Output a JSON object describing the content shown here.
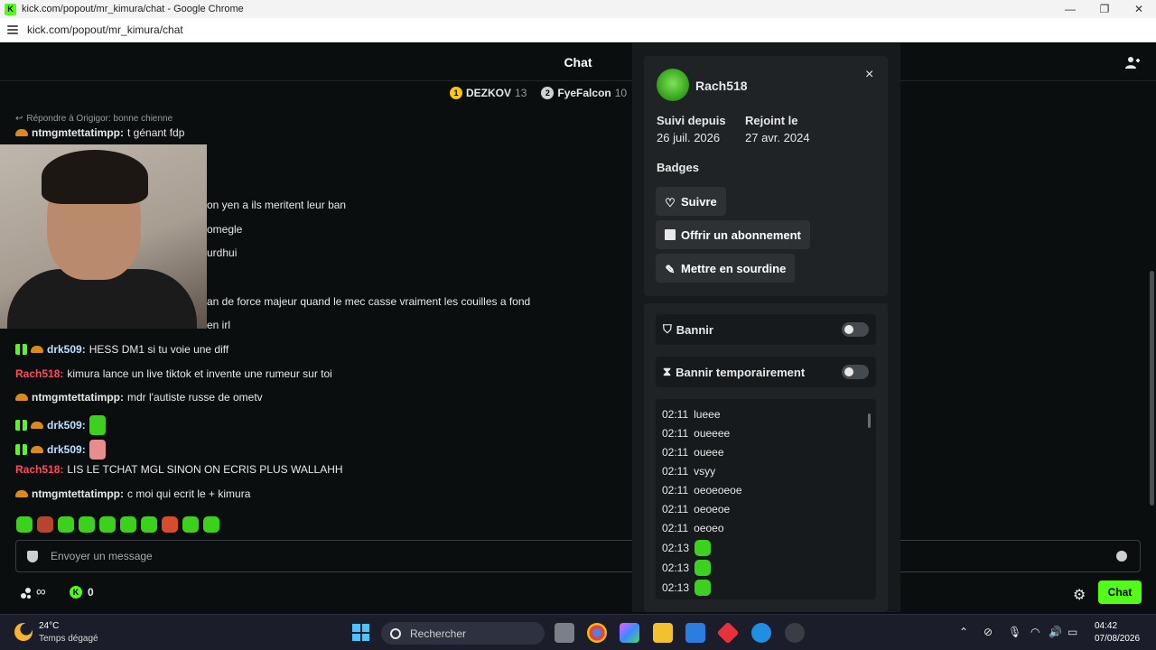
{
  "window": {
    "title": "kick.com/popout/mr_kimura/chat - Google Chrome",
    "url": "kick.com/popout/mr_kimura/chat"
  },
  "chat": {
    "title": "Chat",
    "leaderboard": [
      {
        "rank": "1",
        "name": "DEZKOV",
        "points": "13",
        "color": "#f5c518"
      },
      {
        "rank": "2",
        "name": "FyeFalcon",
        "points": "10",
        "color": "#cfd3d6"
      }
    ],
    "reply_to": "Répondre à Origigor: bonne chienne",
    "messages": [
      {
        "user": "ntmgmtettatimpp:",
        "text": "t génant fdp",
        "user_color": "#e8e8e8",
        "badges": [
          "hat"
        ]
      },
      {
        "user": "",
        "text": "on yen a ils meritent leur ban",
        "user_color": "#e8e8e8",
        "badges": []
      },
      {
        "user": "",
        "text": "omegle",
        "user_color": "#e8e8e8",
        "badges": []
      },
      {
        "user": "",
        "text": "urdhui",
        "user_color": "#e8e8e8",
        "badges": []
      },
      {
        "user": "",
        "text": "an de force majeur quand le mec casse vraiment les couilles a fond",
        "user_color": "#e8e8e8",
        "badges": []
      },
      {
        "user": "",
        "text": "en irl",
        "user_color": "#e8e8e8",
        "badges": []
      },
      {
        "user": "drk509:",
        "text": "HESS DM1 si tu voie une diff",
        "user_color": "#bfe0ff",
        "badges": [
          "gift",
          "hat"
        ]
      },
      {
        "user": "Rach518:",
        "text": "kimura lance un live tiktok et invente une rumeur sur toi",
        "user_color": "#ff4d5e",
        "badges": []
      },
      {
        "user": "ntmgmtettatimpp:",
        "text": "mdr l'autiste russe de ometv",
        "user_color": "#e8e8e8",
        "badges": [
          "hat"
        ]
      },
      {
        "user": "drk509:",
        "text": "",
        "user_color": "#bfe0ff",
        "badges": [
          "gift",
          "hat"
        ],
        "emote": "#3cd11c"
      },
      {
        "user": "drk509:",
        "text": "",
        "user_color": "#bfe0ff",
        "badges": [
          "gift",
          "hat"
        ],
        "emote": "#e88c8c"
      },
      {
        "user": "Rach518:",
        "text": "LIS LE TCHAT MGL SINON ON ECRIS PLUS WALLAHH",
        "user_color": "#ff4d5e",
        "badges": []
      },
      {
        "user": "ntmgmtettatimpp:",
        "text": "c moi qui ecrit le + kimura",
        "user_color": "#e8e8e8",
        "badges": [
          "hat"
        ]
      }
    ],
    "input_placeholder": "Envoyer un message",
    "infinity": "∞",
    "coins": "0",
    "chat_button": "Chat"
  },
  "user_card": {
    "username": "Rach518",
    "close": "×",
    "followed_since_label": "Suivi depuis",
    "followed_since_value": "26 juil. 2026",
    "joined_label": "Rejoint le",
    "joined_value": "27 avr. 2024",
    "badges_label": "Badges",
    "follow_button": "Suivre",
    "gift_sub_button": "Offrir un abonnement",
    "mute_button": "Mettre en sourdine",
    "ban_label": "Bannir",
    "timeout_label": "Bannir temporairement",
    "history": [
      {
        "time": "02:11",
        "text": "lueee"
      },
      {
        "time": "02:11",
        "text": "oueeee"
      },
      {
        "time": "02:11",
        "text": "oueee"
      },
      {
        "time": "02:11",
        "text": "vsyy"
      },
      {
        "time": "02:11",
        "text": "oeoeoeoe"
      },
      {
        "time": "02:11",
        "text": "oeoeoe"
      },
      {
        "time": "02:11",
        "text": "oeoeo"
      },
      {
        "time": "02:13",
        "text": "",
        "emote": true
      },
      {
        "time": "02:13",
        "text": "",
        "emote": true
      },
      {
        "time": "02:13",
        "text": "",
        "emote": true
      }
    ]
  },
  "taskbar": {
    "temperature": "24°C",
    "weather": "Temps dégagé",
    "search_placeholder": "Rechercher",
    "time": "04:42",
    "date": "07/08/2026"
  }
}
